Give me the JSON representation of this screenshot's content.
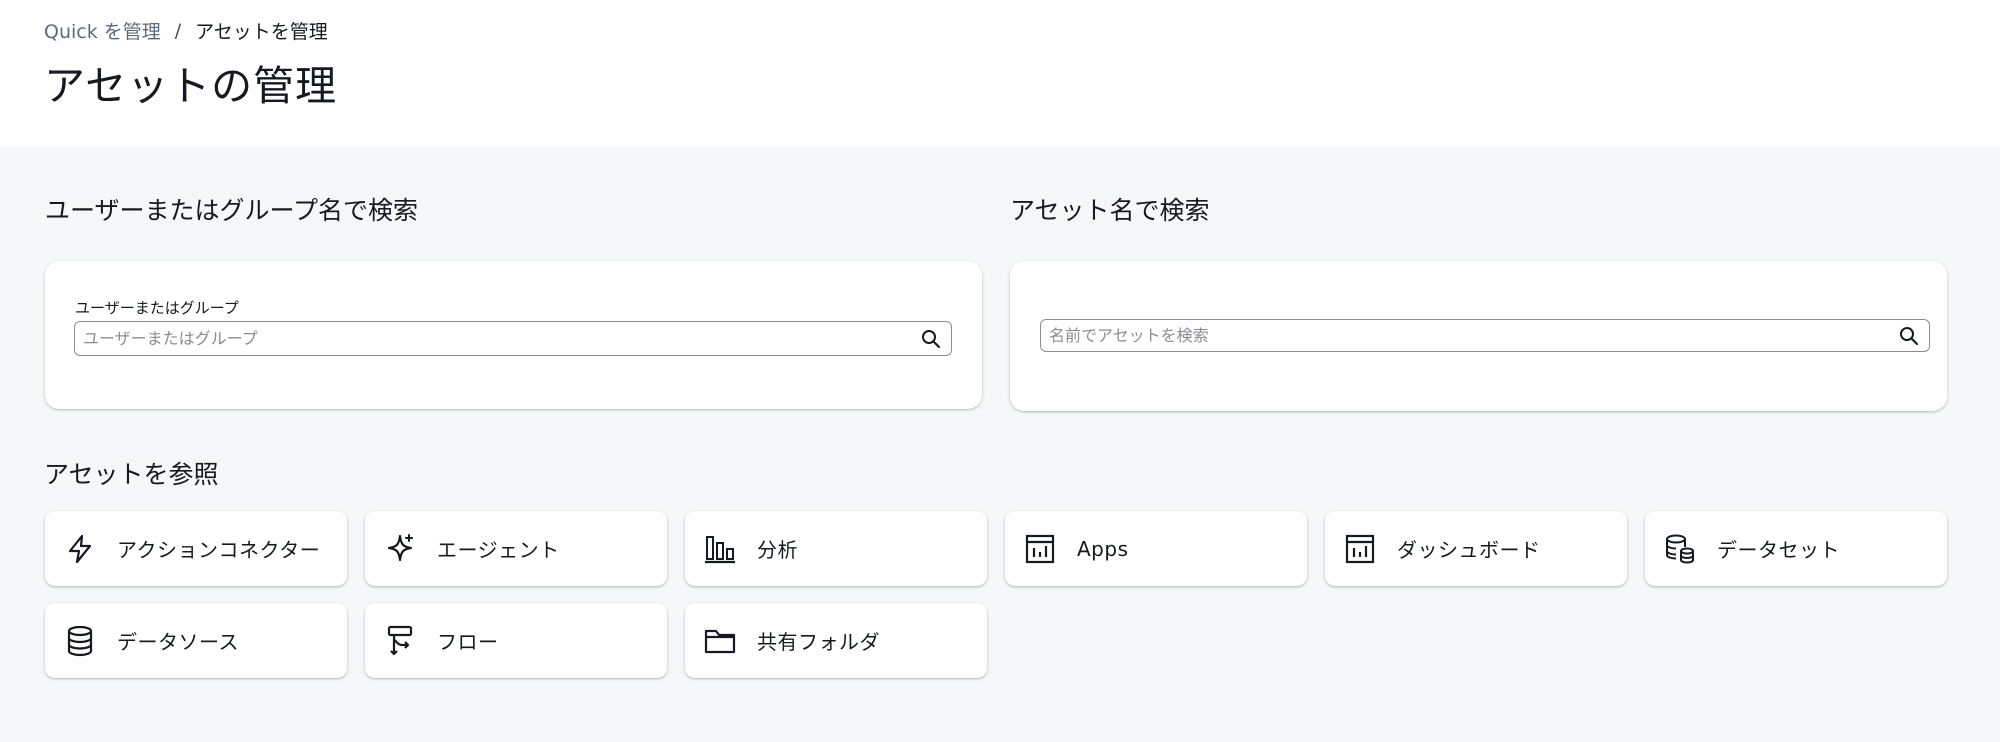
{
  "breadcrumb": {
    "parent": "Quick を管理",
    "separator": "/",
    "current": "アセットを管理"
  },
  "page_title": "アセットの管理",
  "user_search": {
    "heading": "ユーザーまたはグループ名で検索",
    "label": "ユーザーまたはグループ",
    "placeholder": "ユーザーまたはグループ",
    "value": ""
  },
  "asset_search": {
    "heading": "アセット名で検索",
    "placeholder": "名前でアセットを検索",
    "value": ""
  },
  "browse": {
    "heading": "アセットを参照",
    "tiles": [
      {
        "label": "アクションコネクター",
        "icon": "lightning-icon"
      },
      {
        "label": "エージェント",
        "icon": "sparkle-icon"
      },
      {
        "label": "分析",
        "icon": "bar-chart-icon"
      },
      {
        "label": "Apps",
        "icon": "apps-icon"
      },
      {
        "label": "ダッシュボード",
        "icon": "dashboard-icon"
      },
      {
        "label": "データセット",
        "icon": "dataset-icon"
      },
      {
        "label": "データソース",
        "icon": "database-icon"
      },
      {
        "label": "フロー",
        "icon": "flow-icon"
      },
      {
        "label": "共有フォルダ",
        "icon": "folder-icon"
      }
    ]
  },
  "colors": {
    "page_background": "#f6f7f9",
    "card_background": "#ffffff",
    "text": "#16191f",
    "muted_text": "#5f6b7a"
  }
}
